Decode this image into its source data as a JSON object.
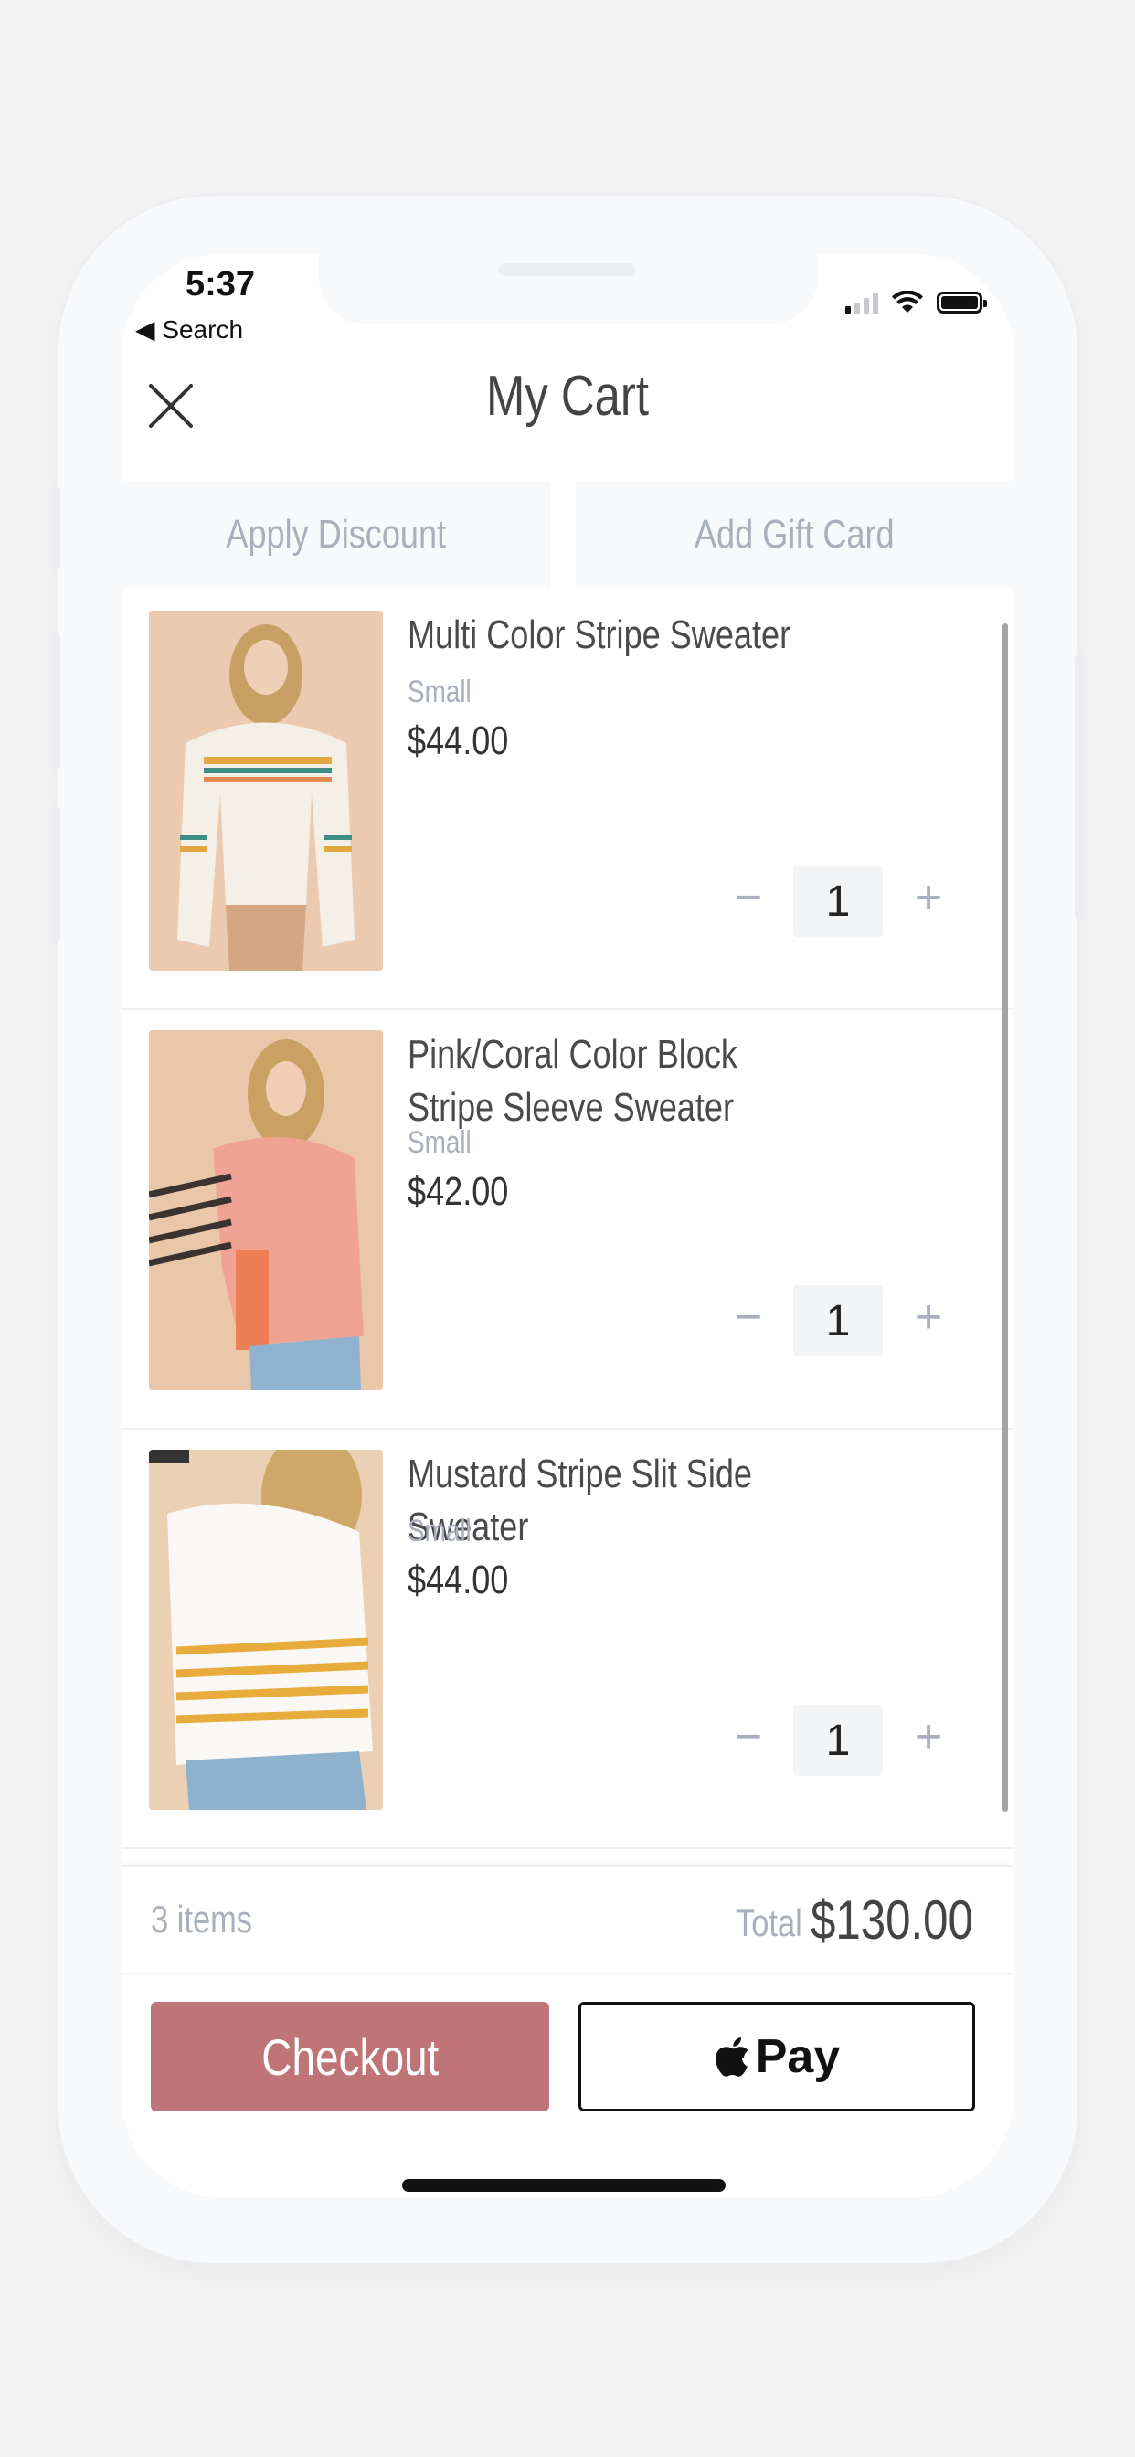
{
  "status": {
    "time": "5:37",
    "back_label": "◀ Search"
  },
  "header": {
    "title": "My Cart"
  },
  "tabs": {
    "discount": "Apply Discount",
    "gift_card": "Add Gift Card"
  },
  "items": [
    {
      "name": "Multi Color Stripe Sweater",
      "size": "Small",
      "price": "$44.00",
      "quantity": "1"
    },
    {
      "name": "Pink/Coral Color Block Stripe Sleeve Sweater",
      "size": "Small",
      "price": "$42.00",
      "quantity": "1"
    },
    {
      "name": "Mustard Stripe Slit Side Sweater",
      "size": "Small",
      "price": "$44.00",
      "quantity": "1"
    }
  ],
  "summary": {
    "items_count": "3 items",
    "total_label": "Total",
    "total_value": "$130.00"
  },
  "actions": {
    "checkout": "Checkout",
    "apple_pay": "Pay"
  },
  "colors": {
    "accent": "#bf7578",
    "muted": "#a9afbd"
  }
}
